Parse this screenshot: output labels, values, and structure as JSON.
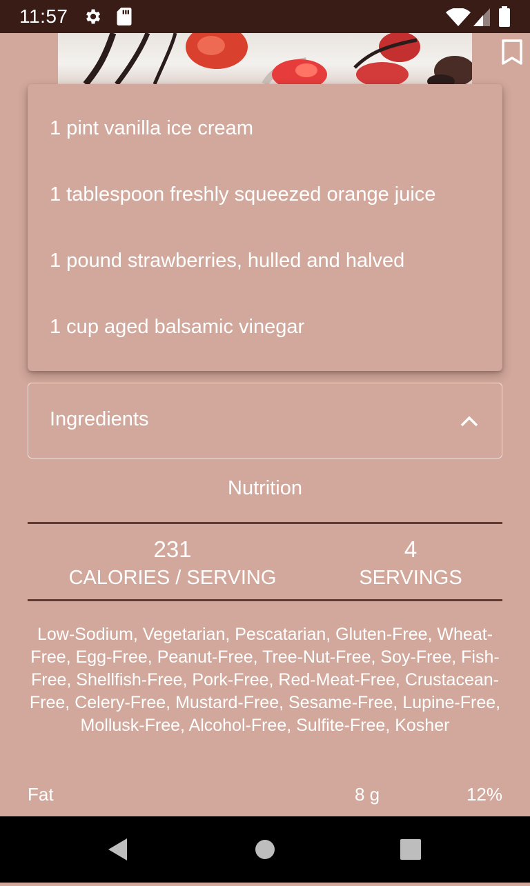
{
  "status_bar": {
    "time": "11:57",
    "icons": [
      "settings-icon",
      "sd-card-icon",
      "wifi-icon",
      "signal-icon",
      "battery-icon"
    ]
  },
  "hero": {
    "image": "strawberries-ice-cream-photo"
  },
  "ingredients_popup": {
    "items": [
      "1 pint vanilla ice cream",
      "1 tablespoon freshly squeezed orange juice",
      "1 pound strawberries, hulled and halved",
      "1 cup aged balsamic vinegar"
    ]
  },
  "ingredients_section": {
    "label": "Ingredients",
    "icon": "chevron-up-icon"
  },
  "nutrition": {
    "title": "Nutrition",
    "calories": {
      "value": "231",
      "label": "CALORIES / SERVING"
    },
    "servings": {
      "value": "4",
      "label": "SERVINGS"
    },
    "health_labels": "Low-Sodium, Vegetarian, Pescatarian, Gluten-Free, Wheat-Free, Egg-Free, Peanut-Free, Tree-Nut-Free, Soy-Free, Fish-Free, Shellfish-Free, Pork-Free, Red-Meat-Free, Crustacean-Free, Celery-Free, Mustard-Free, Sesame-Free, Lupine-Free, Mollusk-Free, Alcohol-Free, Sulfite-Free, Kosher",
    "rows": [
      {
        "name": "Fat",
        "amount": "8 g",
        "percent": "12%"
      }
    ]
  },
  "colors": {
    "background": "#d1a89b",
    "status_bar": "#3a1c17",
    "rule": "#5e3a33",
    "text": "#ffffff"
  }
}
